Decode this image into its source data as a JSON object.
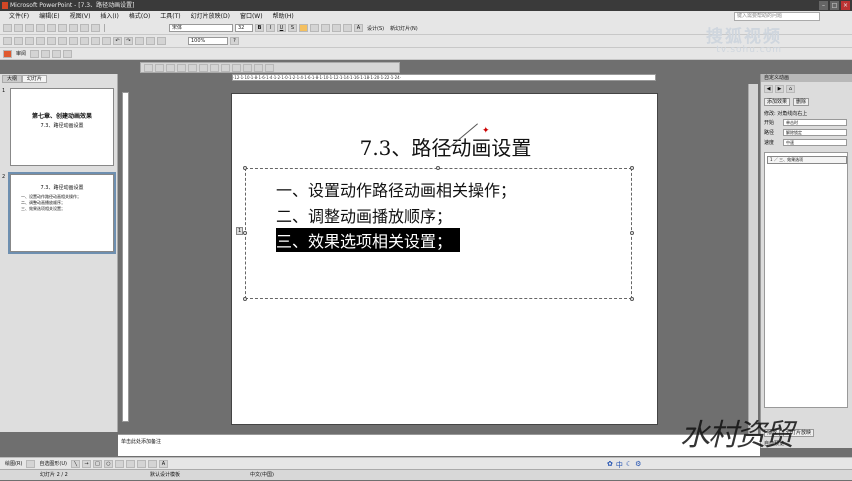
{
  "window": {
    "title": "Microsoft PowerPoint - [7.3、路径动画设置]"
  },
  "menu": [
    "文件(F)",
    "编辑(E)",
    "视图(V)",
    "插入(I)",
    "格式(O)",
    "工具(T)",
    "幻灯片放映(D)",
    "窗口(W)",
    "帮助(H)"
  ],
  "help_placeholder": "键入需要帮助的问题",
  "toolbar": {
    "font": "宋体",
    "size": "32",
    "design": "设计(S)",
    "new_slide": "新幻灯片(N)",
    "zoom": "100%",
    "review": "审阅"
  },
  "watermark": {
    "brand": "搜狐视频",
    "url": "tv.sohu.com"
  },
  "left_tabs": [
    "大纲",
    "幻灯片"
  ],
  "thumbs": [
    {
      "num": "1",
      "title": "第七章、创建动画效果",
      "sub": "7.3、路径动画设置"
    },
    {
      "num": "2",
      "title": "7.3、路径动画设置",
      "lines": [
        "一、设置动作路径动画相关操作；",
        "二、调整动画播放顺序；",
        "三、效果选项相关设置；"
      ]
    }
  ],
  "slide": {
    "title": "7.3、路径动画设置",
    "bullets": [
      "一、设置动作路径动画相关操作；",
      "二、调整动画播放顺序；",
      "三、效果选项相关设置；"
    ],
    "anchor": "1"
  },
  "taskpane": {
    "title": "自定义动画",
    "add": "添加效果",
    "remove": "删除",
    "modify": "修改: 对角线向右上",
    "start_label": "开始",
    "start": "单击时",
    "path_label": "路径",
    "path": "解除锁定",
    "speed_label": "速度",
    "speed": "中速",
    "item": "1 ／ 三、效果选项",
    "play": "播放",
    "slideshow": "幻灯片放映",
    "autopreview": "自动预览"
  },
  "notes": "单击此处添加备注",
  "drawbar": {
    "draw": "绘图(R)",
    "autoshape": "自选图形(U)"
  },
  "status": {
    "slide": "幻灯片 2 / 2",
    "template": "默认设计模板",
    "lang": "中文(中国)"
  },
  "signature": "水村资贸"
}
